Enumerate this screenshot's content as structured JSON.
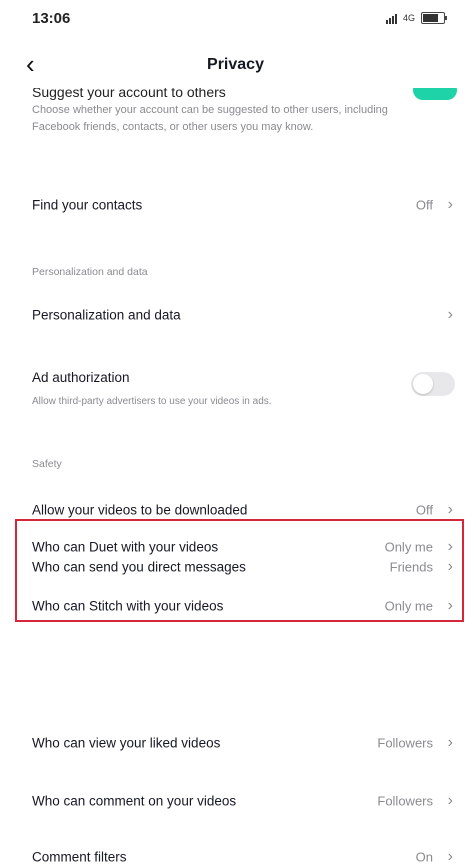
{
  "status_bar": {
    "time": "13:06",
    "network": "4G"
  },
  "header": {
    "title": "Privacy",
    "back_icon": "chevron-left-icon"
  },
  "suggest": {
    "title": "Suggest your account to others",
    "description": "Choose whether your account can be suggested to other users, including Facebook friends, contacts, or other users you may know.",
    "toggle_on": true,
    "accent": "#1fd3a8"
  },
  "rows_top": [
    {
      "label": "Find your contacts",
      "value": "Off"
    }
  ],
  "personalization": {
    "header": "Personalization and data",
    "row_label": "Personalization and data",
    "ad_title": "Ad authorization",
    "ad_desc": "Allow third-party advertisers to use your videos in ads.",
    "ad_toggle_on": false
  },
  "safety": {
    "header": "Safety",
    "rows": [
      {
        "label": "Allow your videos to be downloaded",
        "value": "Off"
      },
      {
        "label": "Who can send you direct messages",
        "value": "Friends"
      },
      {
        "label": "Who can Duet with your videos",
        "value": "Only me"
      },
      {
        "label": "Who can Stitch with your videos",
        "value": "Only me"
      },
      {
        "label": "Who can view your liked videos",
        "value": "Followers"
      },
      {
        "label": "Who can comment on your videos",
        "value": "Followers"
      },
      {
        "label": "Comment filters",
        "value": "On"
      }
    ]
  },
  "highlight_color": "#d6263a"
}
